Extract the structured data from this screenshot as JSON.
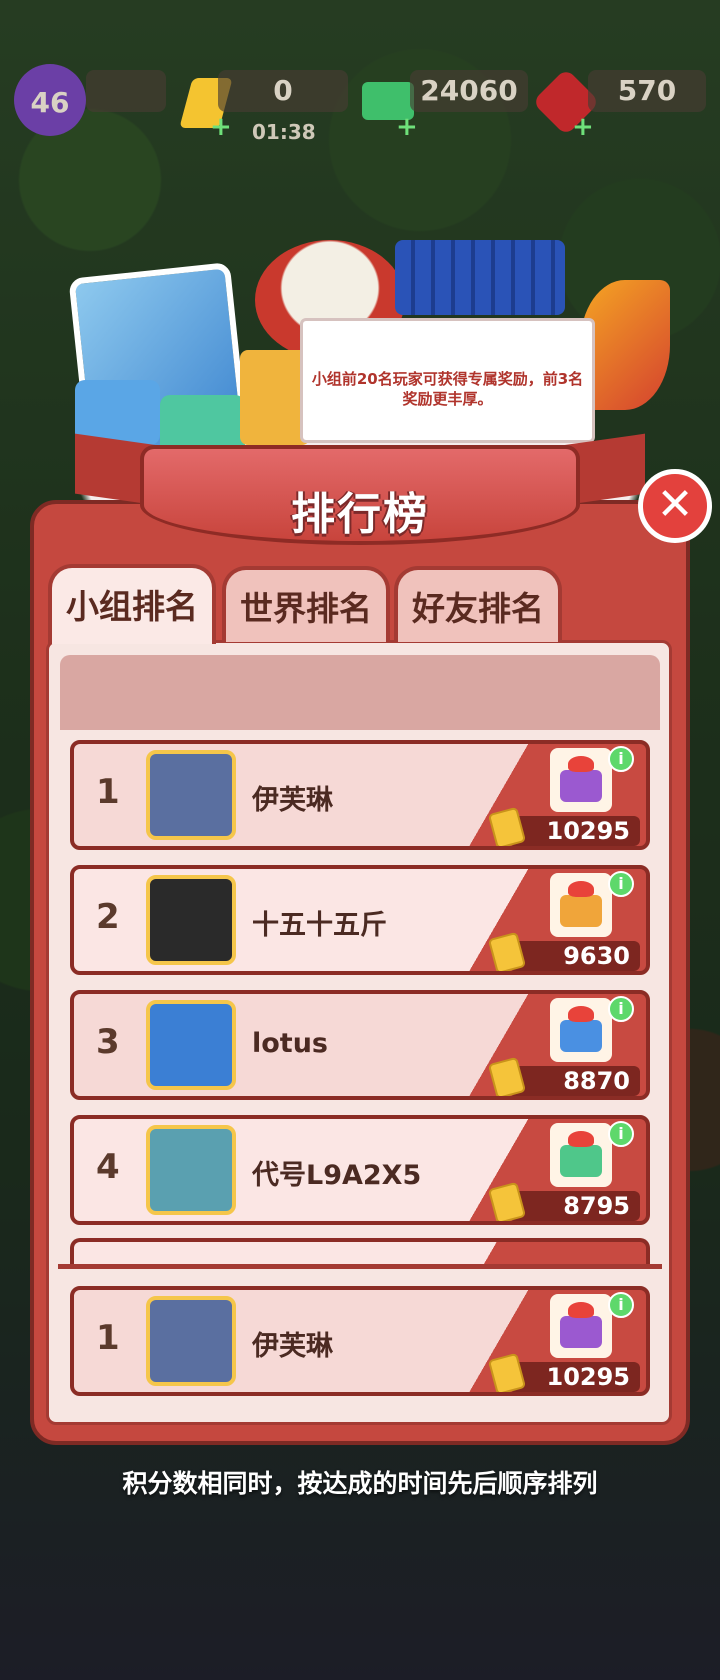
{
  "hud": {
    "level": "46",
    "energy": "0",
    "energy_timer": "01:38",
    "cash": "24060",
    "gems": "570",
    "plus_glyph": "+",
    "icons": [
      "level-badge-icon",
      "energy-bolt-icon",
      "cash-stack-icon",
      "ruby-gem-icon"
    ]
  },
  "banner": {
    "tip": "小组前20名玩家可获得专属奖励，前3名奖励更丰厚。"
  },
  "panel": {
    "title": "排行榜",
    "close_glyph": "✕"
  },
  "tabs": [
    {
      "label": "小组排名",
      "active": true
    },
    {
      "label": "世界排名",
      "active": false
    },
    {
      "label": "好友排名",
      "active": false
    }
  ],
  "leaderboard": [
    {
      "rank": "1",
      "name": "伊芙琳",
      "score": "10295",
      "gift_color": "#9b59d0",
      "avatar_color": "#5a6fa0"
    },
    {
      "rank": "2",
      "name": "十五十五斤",
      "score": "9630",
      "gift_color": "#f0a53a",
      "avatar_color": "#2a2a2a"
    },
    {
      "rank": "3",
      "name": "lotus",
      "score": "8870",
      "gift_color": "#4a90e2",
      "avatar_color": "#3b7fd4"
    },
    {
      "rank": "4",
      "name": "代号L9A2X5",
      "score": "8795",
      "gift_color": "#4fc78a",
      "avatar_color": "#5aa0b0"
    }
  ],
  "self_row": {
    "rank": "1",
    "name": "伊芙琳",
    "score": "10295",
    "gift_color": "#9b59d0",
    "avatar_color": "#5a6fa0"
  },
  "info_glyph": "i",
  "footnote": "积分数相同时，按达成的时间先后顺序排列",
  "colors": {
    "panel": "#c5483f",
    "panel_border": "#7e2a24",
    "row_accent": "#c84a41",
    "info_badge": "#5ed86b"
  }
}
